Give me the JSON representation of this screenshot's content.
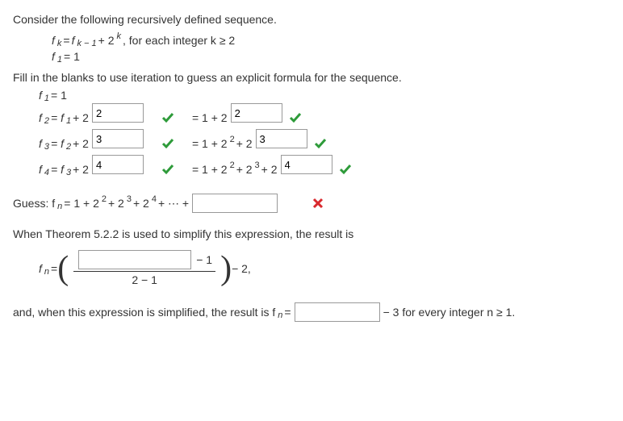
{
  "intro": "Consider the following recursively defined sequence.",
  "recurrence": {
    "fk": "f",
    "k": "k",
    "eq": " = ",
    "fk1": "f",
    "km1": "k − 1",
    "plus": " + 2",
    "expk": "k",
    "forEach": ", for each integer k ≥ 2",
    "f1eq": " = 1",
    "f1": "f",
    "one": "1"
  },
  "fillIn": "Fill in the blanks to use iteration to guess an explicit formula for the sequence.",
  "lines": {
    "l1_lhs": "f",
    "l1_sub": "1",
    "l1_rhs": " = 1",
    "l2_lhs": "f",
    "l2_sub": "2",
    "l2_mid": " = f",
    "l2_sub2": "1",
    "l2_plus": " + 2",
    "l2_val": "2",
    "l2_rhs_pre": "= 1 + 2",
    "l2_val2": "2",
    "l3_lhs": "f",
    "l3_sub": "3",
    "l3_mid": " = f",
    "l3_sub2": "2",
    "l3_plus": " + 2",
    "l3_val": "3",
    "l3_rhs_pre": "= 1 + 2",
    "l3_sq": "2",
    "l3_plus2": " + 2",
    "l3_val2": "3",
    "l4_lhs": "f",
    "l4_sub": "4",
    "l4_mid": " = f",
    "l4_sub2": "3",
    "l4_plus": " + 2",
    "l4_val": "4",
    "l4_rhs_pre": "= 1 + 2",
    "l4_sq": "2",
    "l4_plus2": " + 2",
    "l4_cu": "3",
    "l4_plus3": " + 2",
    "l4_val2": "4"
  },
  "guess": {
    "label": "Guess: f",
    "sub": "n",
    "eq": " = 1 + 2",
    "e2": "2",
    "p1": " + 2",
    "e3": "3",
    "p2": " + 2",
    "e4": "4",
    "tail": " + ⋯ + ",
    "val": ""
  },
  "theorem": "When Theorem 5.2.2 is used to simplify this expression, the result is",
  "closed": {
    "fn": "f",
    "sub": "n",
    "eq": " = ",
    "numVal": "",
    "numTail": " − 1",
    "den": "2 − 1",
    "tail": " − 2,"
  },
  "final": {
    "pre": "and, when this expression is simplified, the result is f",
    "sub": "n",
    "eq": " = ",
    "val": "",
    "post": " − 3 for every integer n ≥ 1."
  }
}
